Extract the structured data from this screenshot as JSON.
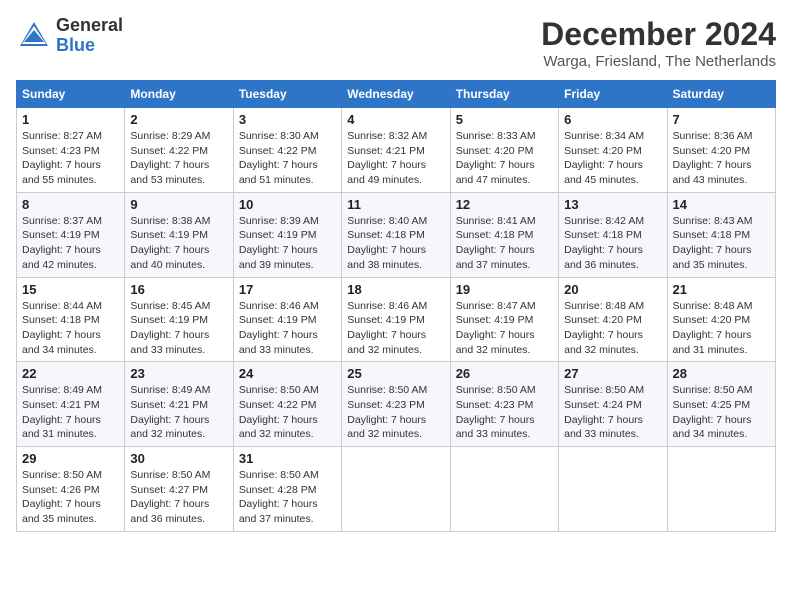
{
  "header": {
    "logo_line1": "General",
    "logo_line2": "Blue",
    "month_title": "December 2024",
    "location": "Warga, Friesland, The Netherlands"
  },
  "days_of_week": [
    "Sunday",
    "Monday",
    "Tuesday",
    "Wednesday",
    "Thursday",
    "Friday",
    "Saturday"
  ],
  "weeks": [
    [
      {
        "day": "1",
        "sunrise": "8:27 AM",
        "sunset": "4:23 PM",
        "daylight": "7 hours and 55 minutes."
      },
      {
        "day": "2",
        "sunrise": "8:29 AM",
        "sunset": "4:22 PM",
        "daylight": "7 hours and 53 minutes."
      },
      {
        "day": "3",
        "sunrise": "8:30 AM",
        "sunset": "4:22 PM",
        "daylight": "7 hours and 51 minutes."
      },
      {
        "day": "4",
        "sunrise": "8:32 AM",
        "sunset": "4:21 PM",
        "daylight": "7 hours and 49 minutes."
      },
      {
        "day": "5",
        "sunrise": "8:33 AM",
        "sunset": "4:20 PM",
        "daylight": "7 hours and 47 minutes."
      },
      {
        "day": "6",
        "sunrise": "8:34 AM",
        "sunset": "4:20 PM",
        "daylight": "7 hours and 45 minutes."
      },
      {
        "day": "7",
        "sunrise": "8:36 AM",
        "sunset": "4:20 PM",
        "daylight": "7 hours and 43 minutes."
      }
    ],
    [
      {
        "day": "8",
        "sunrise": "8:37 AM",
        "sunset": "4:19 PM",
        "daylight": "7 hours and 42 minutes."
      },
      {
        "day": "9",
        "sunrise": "8:38 AM",
        "sunset": "4:19 PM",
        "daylight": "7 hours and 40 minutes."
      },
      {
        "day": "10",
        "sunrise": "8:39 AM",
        "sunset": "4:19 PM",
        "daylight": "7 hours and 39 minutes."
      },
      {
        "day": "11",
        "sunrise": "8:40 AM",
        "sunset": "4:18 PM",
        "daylight": "7 hours and 38 minutes."
      },
      {
        "day": "12",
        "sunrise": "8:41 AM",
        "sunset": "4:18 PM",
        "daylight": "7 hours and 37 minutes."
      },
      {
        "day": "13",
        "sunrise": "8:42 AM",
        "sunset": "4:18 PM",
        "daylight": "7 hours and 36 minutes."
      },
      {
        "day": "14",
        "sunrise": "8:43 AM",
        "sunset": "4:18 PM",
        "daylight": "7 hours and 35 minutes."
      }
    ],
    [
      {
        "day": "15",
        "sunrise": "8:44 AM",
        "sunset": "4:18 PM",
        "daylight": "7 hours and 34 minutes."
      },
      {
        "day": "16",
        "sunrise": "8:45 AM",
        "sunset": "4:19 PM",
        "daylight": "7 hours and 33 minutes."
      },
      {
        "day": "17",
        "sunrise": "8:46 AM",
        "sunset": "4:19 PM",
        "daylight": "7 hours and 33 minutes."
      },
      {
        "day": "18",
        "sunrise": "8:46 AM",
        "sunset": "4:19 PM",
        "daylight": "7 hours and 32 minutes."
      },
      {
        "day": "19",
        "sunrise": "8:47 AM",
        "sunset": "4:19 PM",
        "daylight": "7 hours and 32 minutes."
      },
      {
        "day": "20",
        "sunrise": "8:48 AM",
        "sunset": "4:20 PM",
        "daylight": "7 hours and 32 minutes."
      },
      {
        "day": "21",
        "sunrise": "8:48 AM",
        "sunset": "4:20 PM",
        "daylight": "7 hours and 31 minutes."
      }
    ],
    [
      {
        "day": "22",
        "sunrise": "8:49 AM",
        "sunset": "4:21 PM",
        "daylight": "7 hours and 31 minutes."
      },
      {
        "day": "23",
        "sunrise": "8:49 AM",
        "sunset": "4:21 PM",
        "daylight": "7 hours and 32 minutes."
      },
      {
        "day": "24",
        "sunrise": "8:50 AM",
        "sunset": "4:22 PM",
        "daylight": "7 hours and 32 minutes."
      },
      {
        "day": "25",
        "sunrise": "8:50 AM",
        "sunset": "4:23 PM",
        "daylight": "7 hours and 32 minutes."
      },
      {
        "day": "26",
        "sunrise": "8:50 AM",
        "sunset": "4:23 PM",
        "daylight": "7 hours and 33 minutes."
      },
      {
        "day": "27",
        "sunrise": "8:50 AM",
        "sunset": "4:24 PM",
        "daylight": "7 hours and 33 minutes."
      },
      {
        "day": "28",
        "sunrise": "8:50 AM",
        "sunset": "4:25 PM",
        "daylight": "7 hours and 34 minutes."
      }
    ],
    [
      {
        "day": "29",
        "sunrise": "8:50 AM",
        "sunset": "4:26 PM",
        "daylight": "7 hours and 35 minutes."
      },
      {
        "day": "30",
        "sunrise": "8:50 AM",
        "sunset": "4:27 PM",
        "daylight": "7 hours and 36 minutes."
      },
      {
        "day": "31",
        "sunrise": "8:50 AM",
        "sunset": "4:28 PM",
        "daylight": "7 hours and 37 minutes."
      },
      null,
      null,
      null,
      null
    ]
  ]
}
